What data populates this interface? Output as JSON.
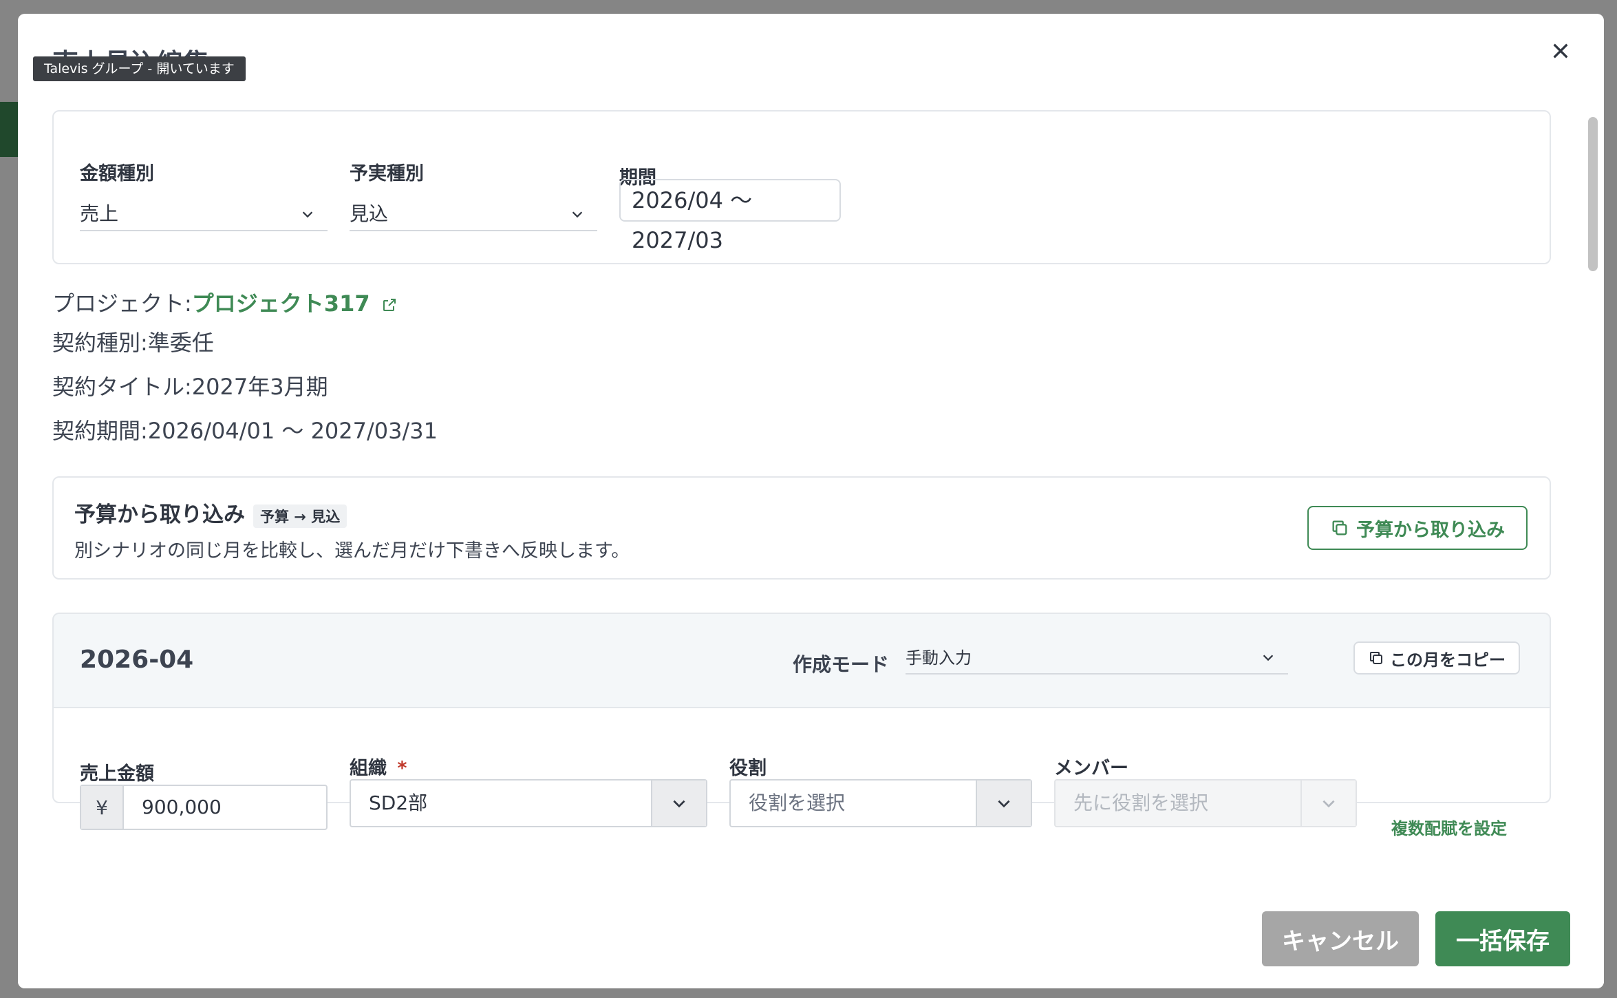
{
  "modal": {
    "title": "売上見込編集",
    "tooltip": "Talevis グループ - 開いています",
    "close_label": "×"
  },
  "filters": {
    "amount_type_label": "金額種別",
    "amount_type_value": "売上",
    "plan_type_label": "予実種別",
    "plan_type_value": "見込",
    "period_label": "期間",
    "period_value": "2026/04 〜 2027/03"
  },
  "info": {
    "project_prefix": "プロジェクト:",
    "project_name": "プロジェクト317",
    "contract_type": "契約種別:準委任",
    "contract_title": "契約タイトル:2027年3月期",
    "contract_period": "契約期間:2026/04/01 〜 2027/03/31"
  },
  "import_card": {
    "title": "予算から取り込み",
    "badge": "予算 → 見込",
    "description": "別シナリオの同じ月を比較し、選んだ月だけ下書きへ反映します。",
    "button_label": "予算から取り込み"
  },
  "month": {
    "label": "2026-04",
    "mode_label": "作成モード",
    "mode_value": "手動入力",
    "copy_label": "この月をコピー",
    "sales_amount_label": "売上金額",
    "currency_symbol": "¥",
    "sales_amount_value": "900,000",
    "org_label": "組織",
    "org_required": "*",
    "org_value": "SD2部",
    "role_label": "役割",
    "role_placeholder": "役割を選択",
    "member_label": "メンバー",
    "member_placeholder": "先に役割を選択",
    "multi_alloc_link": "複数配賦を設定"
  },
  "footer": {
    "cancel_label": "キャンセル",
    "save_label": "一括保存"
  },
  "colors": {
    "accent": "#3f8a55",
    "cancel_bg": "#a6a6a6",
    "required": "#c0392b"
  }
}
